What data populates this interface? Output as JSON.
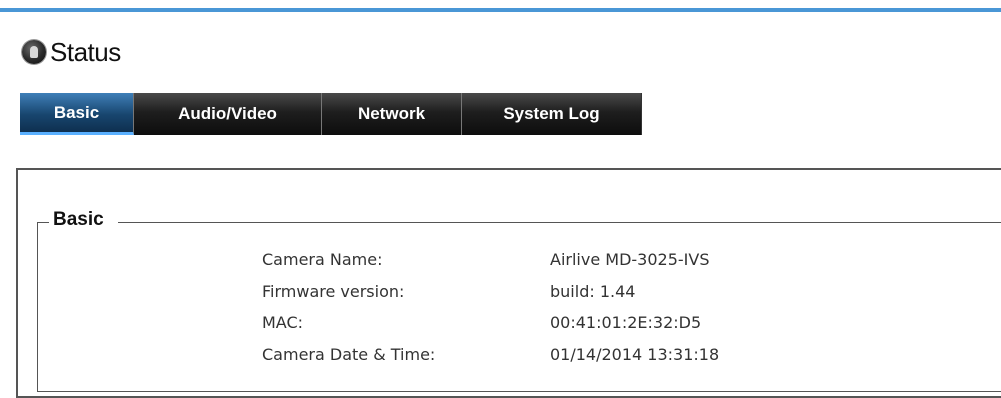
{
  "page": {
    "title": "Status",
    "icon": "camera-status-icon"
  },
  "tabs": [
    {
      "label": "Basic",
      "active": true
    },
    {
      "label": "Audio/Video",
      "active": false
    },
    {
      "label": "Network",
      "active": false
    },
    {
      "label": "System Log",
      "active": false
    }
  ],
  "basic_section": {
    "legend": "Basic",
    "rows": [
      {
        "label": "Camera Name:",
        "value": "Airlive MD-3025-IVS"
      },
      {
        "label": "Firmware version:",
        "value": "build: 1.44"
      },
      {
        "label": "MAC:",
        "value": "00:41:01:2E:32:D5"
      },
      {
        "label": "Camera Date & Time:",
        "value": "01/14/2014 13:31:18"
      }
    ]
  },
  "colors": {
    "accent_bar": "#4a97d6",
    "active_tab": "#18466f",
    "inactive_tab": "#1e1e1e"
  }
}
